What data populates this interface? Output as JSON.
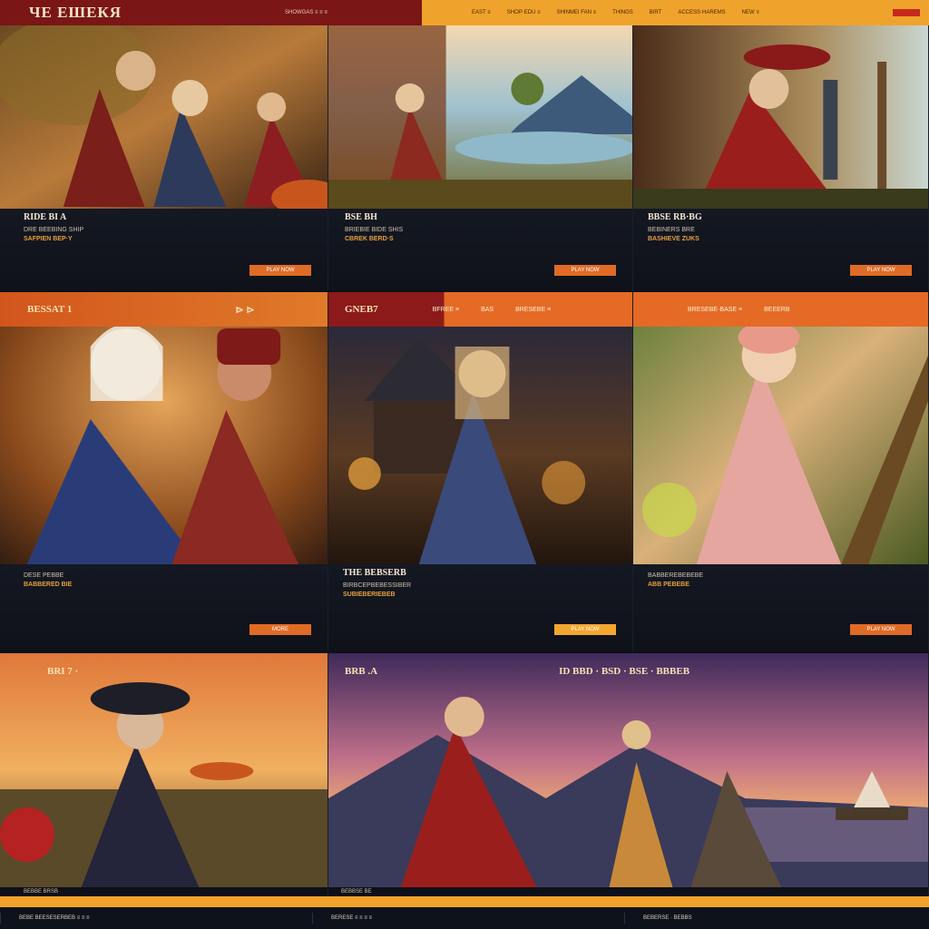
{
  "header": {
    "logo": "ЧЕ ЕШЕКЯ",
    "tagline": "SHOWGAS ≡ ≡ ≡",
    "nav": [
      "EAST ≡",
      "SHOP·EDU ≡",
      "SHINMEI FAN ≡",
      "THINGS",
      "BIRT",
      "ACCESS·HAREMS",
      "NEW ≡"
    ]
  },
  "cards": [
    {
      "title": "RIDE BI A",
      "subtitle": "DRE BEEBING SHIP",
      "meta": "SAFPIEN BEP·Y",
      "button": "PLAY NOW"
    },
    {
      "title": "BSE BH",
      "subtitle": "BRIEBIE BIDE SHIS",
      "meta": "CBREK BERD·S",
      "button": "PLAY NOW"
    },
    {
      "title": "BBSE RB·BG",
      "subtitle": "BEBINERS BRE",
      "meta": "BASHIEVE ZUKS",
      "button": "PLAY NOW"
    },
    {
      "title": "",
      "subtitle": "DESE PEBBE",
      "meta": "BABBERED BIE",
      "button": "MORE"
    },
    {
      "title": "THE BEBSERB",
      "subtitle": "BIRBCEPBEBESSIBER",
      "meta": "SUBIEBERIEBEB",
      "button": "PLAY NOW"
    },
    {
      "title": "",
      "subtitle": "BABBEREBEBEBE",
      "meta": "ABB PEBEBE",
      "button": "PLAY NOW"
    },
    {
      "title": "",
      "subtitle": "BEBBE BRSB",
      "meta": "",
      "button": ""
    },
    {
      "title": "",
      "subtitle": "BEBBSE BE",
      "meta": "",
      "button": ""
    }
  ],
  "row2": {
    "left_title": "BESSAT 1",
    "left_icon": "⊳ ⊳",
    "center_title": "GNEB7",
    "links": [
      "BFREE ≡",
      "BAS",
      "BRESEBE ≡",
      "BRESEBE·BASE ≡",
      "BEEERB"
    ]
  },
  "row3": {
    "left_title": "BRI 7 ·",
    "center_titles": [
      "BRB .A",
      "ID  BBD  ·  BSD  ·  BSE  ·  BBBEB"
    ]
  },
  "footer": {
    "cells": [
      "BEBE BEESESERBEB ≡ ≡ ≡",
      "BERESE ≡ ≡ ≡ ≡",
      "BEBERSE ·  BEBBS"
    ]
  },
  "colors": {
    "brand_red": "#7a1616",
    "accent_orange": "#e06b26",
    "accent_gold": "#f3a72f",
    "panel_dark": "#10131b"
  }
}
